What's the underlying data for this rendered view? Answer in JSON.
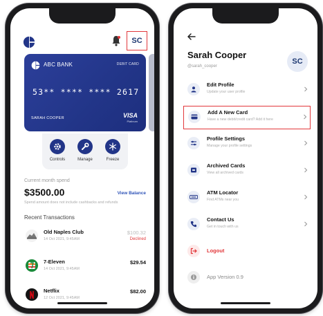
{
  "colors": {
    "brand_blue": "#223588",
    "accent_link": "#2f54b8",
    "alert_red": "#e2373a",
    "icon_bg": "#e9edf6"
  },
  "left_screen": {
    "header": {
      "user_initials": "SC"
    },
    "card": {
      "bank_name": "ABC BANK",
      "card_type": "DEBIT CARD",
      "number": "53** **** **** 2617",
      "holder": "SARAH COOPER",
      "network": "VISA",
      "tier": "Platinum"
    },
    "actions": [
      {
        "label": "Controls",
        "icon": "gear-icon"
      },
      {
        "label": "Manage",
        "icon": "wrench-icon"
      },
      {
        "label": "Freeze",
        "icon": "snowflake-icon"
      }
    ],
    "spend": {
      "label": "Current month spend",
      "amount": "$3500.00",
      "link": "View Balance",
      "note": "Spend amount does not include cashbacks and refunds"
    },
    "recent_title": "Recent Transactions",
    "transactions": [
      {
        "name": "Old Naples Club",
        "date": "14 Oct 2021, 9:45AM",
        "amount": "$100.32",
        "status": "Declined",
        "icon": "club-logo-icon"
      },
      {
        "name": "7-Eleven",
        "date": "14 Oct 2021, 9:45AM",
        "amount": "$29.54",
        "status": "",
        "icon": "seven-eleven-logo-icon"
      },
      {
        "name": "Netflix",
        "date": "12 Oct 2021, 9:45AM",
        "amount": "$82.00",
        "status": "",
        "icon": "netflix-logo-icon"
      }
    ]
  },
  "right_screen": {
    "profile": {
      "name": "Sarah Cooper",
      "handle": "@sarah_cooper",
      "initials": "SC"
    },
    "menu": [
      {
        "title": "Edit Profile",
        "subtitle": "Update your user profile",
        "icon": "user-icon"
      },
      {
        "title": "Add A New Card",
        "subtitle": "Have a new debit/credit card? Add it here",
        "icon": "card-icon"
      },
      {
        "title": "Profile Settings",
        "subtitle": "Manage your profile settings",
        "icon": "sliders-icon"
      },
      {
        "title": "Archived Cards",
        "subtitle": "View all archived cards",
        "icon": "archive-icon"
      },
      {
        "title": "ATM Locator",
        "subtitle": "Find ATMs near you",
        "icon": "atm-icon"
      },
      {
        "title": "Contact Us",
        "subtitle": "Get in touch with us",
        "icon": "phone-icon"
      }
    ],
    "logout": "Logout",
    "version": "App Version 0.9"
  }
}
